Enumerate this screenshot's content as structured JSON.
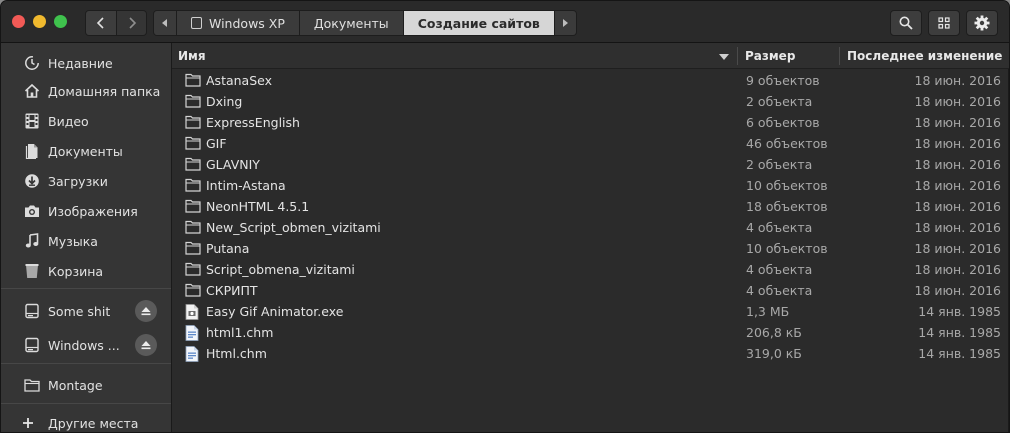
{
  "header": {
    "path": [
      {
        "label": "Windows XP",
        "icon": "drive-icon"
      },
      {
        "label": "Документы"
      },
      {
        "label": "Создание сайтов",
        "active": true
      }
    ]
  },
  "sidebar": {
    "places": [
      {
        "label": "Недавние",
        "icon": "clock-icon"
      },
      {
        "label": "Домашняя папка",
        "icon": "home-icon"
      },
      {
        "label": "Видео",
        "icon": "film-icon"
      },
      {
        "label": "Документы",
        "icon": "document-icon"
      },
      {
        "label": "Загрузки",
        "icon": "download-icon"
      },
      {
        "label": "Изображения",
        "icon": "camera-icon"
      },
      {
        "label": "Музыка",
        "icon": "music-icon"
      },
      {
        "label": "Корзина",
        "icon": "trash-icon"
      }
    ],
    "devices": [
      {
        "label": "Some shit",
        "icon": "drive-icon"
      },
      {
        "label": "Windows ...",
        "icon": "drive-icon"
      }
    ],
    "network": [
      {
        "label": "Montage",
        "icon": "folder-icon"
      }
    ],
    "other": {
      "label": "Другие места",
      "icon": "plus-icon"
    }
  },
  "columns": {
    "name": "Имя",
    "size": "Размер",
    "modified": "Последнее изменение"
  },
  "files": [
    {
      "name": "AstanaSex",
      "size": "9 объектов",
      "modified": "18 июн. 2016",
      "type": "folder"
    },
    {
      "name": "Dxing",
      "size": "2 объекта",
      "modified": "18 июн. 2016",
      "type": "folder"
    },
    {
      "name": "ExpressEnglish",
      "size": "6 объектов",
      "modified": "18 июн. 2016",
      "type": "folder"
    },
    {
      "name": "GIF",
      "size": "46 объектов",
      "modified": "18 июн. 2016",
      "type": "folder"
    },
    {
      "name": "GLAVNIY",
      "size": "2 объекта",
      "modified": "18 июн. 2016",
      "type": "folder"
    },
    {
      "name": "Intim-Astana",
      "size": "10 объектов",
      "modified": "18 июн. 2016",
      "type": "folder"
    },
    {
      "name": "NeonHTML 4.5.1",
      "size": "18 объектов",
      "modified": "18 июн. 2016",
      "type": "folder"
    },
    {
      "name": "New_Script_obmen_vizitami",
      "size": "4 объекта",
      "modified": "18 июн. 2016",
      "type": "folder"
    },
    {
      "name": "Putana",
      "size": "10 объектов",
      "modified": "18 июн. 2016",
      "type": "folder"
    },
    {
      "name": "Script_obmena_vizitami",
      "size": "4 объекта",
      "modified": "18 июн. 2016",
      "type": "folder"
    },
    {
      "name": "СКРИПТ",
      "size": "4 объекта",
      "modified": "18 июн. 2016",
      "type": "folder"
    },
    {
      "name": "Easy Gif Animator.exe",
      "size": "1,3 МБ",
      "modified": "14 янв. 1985",
      "type": "exe"
    },
    {
      "name": "html1.chm",
      "size": "206,8 кБ",
      "modified": "14 янв. 1985",
      "type": "chm"
    },
    {
      "name": "Html.chm",
      "size": "319,0 кБ",
      "modified": "14 янв. 1985",
      "type": "chm"
    }
  ]
}
